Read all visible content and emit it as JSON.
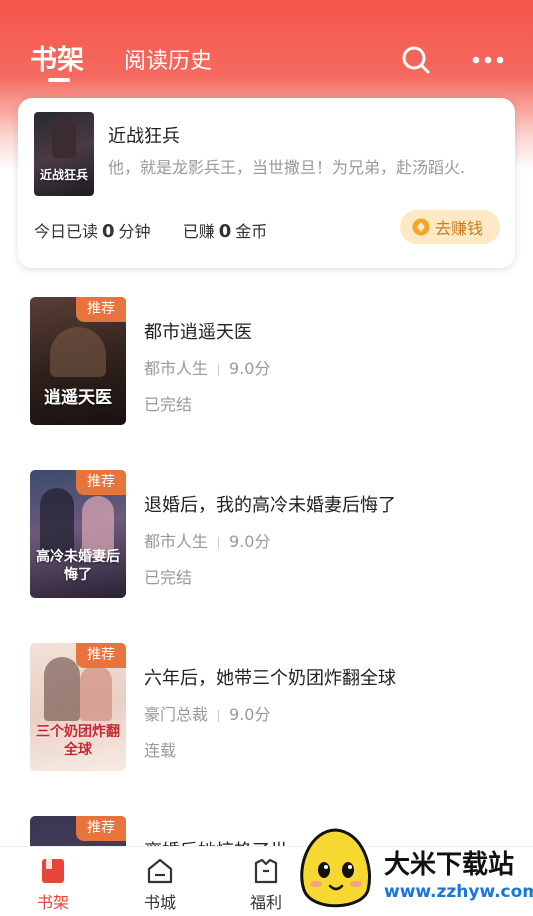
{
  "header": {
    "tabs": [
      {
        "label": "书架",
        "active": true
      },
      {
        "label": "阅读历史",
        "active": false
      }
    ],
    "icons": [
      "search-icon",
      "more-icon"
    ]
  },
  "reading_card": {
    "title": "近战狂兵",
    "description": "他，就是龙影兵王，当世撒旦！为兄弟，赴汤蹈火.",
    "today_read_prefix": "今日已读",
    "today_read_value": "0",
    "today_read_unit": "分钟",
    "earned_prefix": "已赚",
    "earned_value": "0",
    "earned_unit": "金币",
    "earn_button": "去赚钱",
    "cover_text": "近战狂兵"
  },
  "books": [
    {
      "title": "都市逍遥天医",
      "category": "都市人生",
      "score": "9.0分",
      "status": "已完结",
      "tag": "推荐",
      "cover_text": "逍遥天医"
    },
    {
      "title": "退婚后，我的高冷未婚妻后悔了",
      "category": "都市人生",
      "score": "9.0分",
      "status": "已完结",
      "tag": "推荐",
      "cover_text": "高冷未婚妻后悔了"
    },
    {
      "title": "六年后，她带三个奶团炸翻全球",
      "category": "豪门总裁",
      "score": "9.0分",
      "status": "连载",
      "tag": "推荐",
      "cover_text": "三个奶团炸翻全球"
    },
    {
      "title": "离婚后她惊艳了世",
      "category": "",
      "score": "",
      "status": "",
      "tag": "推荐",
      "cover_text": ""
    }
  ],
  "bottom_nav": [
    {
      "label": "书架",
      "icon": "bookshelf-icon",
      "active": true
    },
    {
      "label": "书城",
      "icon": "bookstore-icon",
      "active": false
    },
    {
      "label": "福利",
      "icon": "welfare-icon",
      "active": false
    }
  ],
  "watermark": {
    "text": "大米下载站",
    "url": "www.zzhyw.com"
  },
  "colors": {
    "accent": "#e8453c",
    "header_gradient_top": "#f4544a",
    "tag_orange": "#e8743d",
    "earn_bg": "#fde9c4",
    "earn_text": "#c87c1c"
  }
}
